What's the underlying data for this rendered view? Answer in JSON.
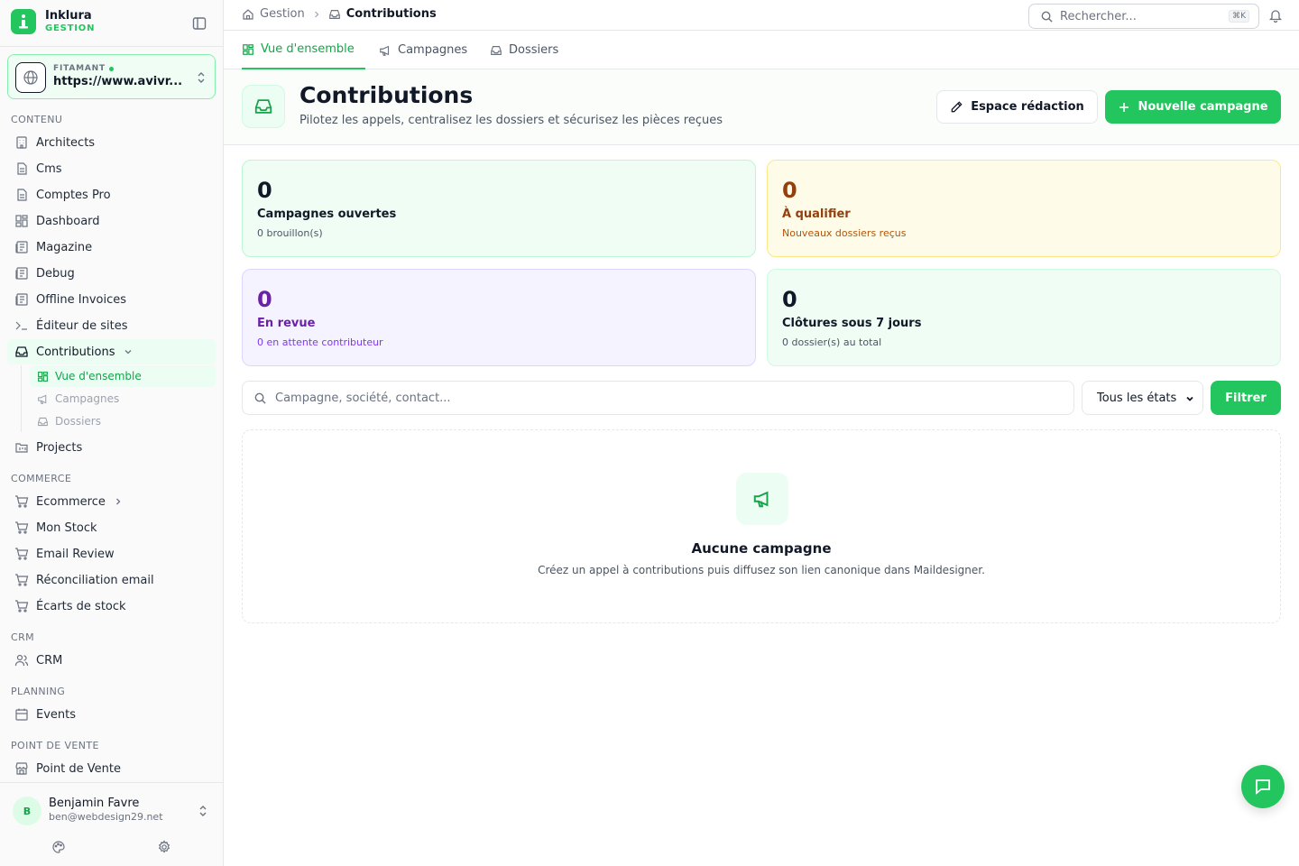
{
  "brand": {
    "name": "Inklura",
    "subtitle": "GESTION"
  },
  "site": {
    "label": "FITAMANT",
    "url": "https://www.avivr..."
  },
  "sidebar": {
    "sections": {
      "contenu": "CONTENU",
      "commerce": "COMMERCE",
      "crm": "CRM",
      "planning": "PLANNING",
      "pdv": "POINT DE VENTE"
    },
    "items": {
      "architects": "Architects",
      "cms": "Cms",
      "comptes_pro": "Comptes Pro",
      "dashboard": "Dashboard",
      "magazine": "Magazine",
      "debug": "Debug",
      "offline_invoices": "Offline Invoices",
      "editeur": "Éditeur de sites",
      "contributions": "Contributions",
      "projects": "Projects",
      "ecommerce": "Ecommerce",
      "mon_stock": "Mon Stock",
      "email_review": "Email Review",
      "reconciliation": "Réconciliation email",
      "ecarts": "Écarts de stock",
      "crm": "CRM",
      "events": "Events",
      "point_de_vente": "Point de Vente"
    },
    "subitems": {
      "overview": "Vue d'ensemble",
      "campagnes": "Campagnes",
      "dossiers": "Dossiers"
    }
  },
  "user": {
    "initial": "B",
    "name": "Benjamin Favre",
    "email": "ben@webdesign29.net"
  },
  "breadcrumb": {
    "root": "Gestion",
    "current": "Contributions"
  },
  "search": {
    "placeholder": "Rechercher...",
    "shortcut": "⌘K"
  },
  "tabs": {
    "overview": "Vue d'ensemble",
    "campagnes": "Campagnes",
    "dossiers": "Dossiers"
  },
  "header": {
    "title": "Contributions",
    "subtitle": "Pilotez les appels, centralisez les dossiers et sécurisez les pièces reçues",
    "redaction_label": "Espace rédaction",
    "new_campaign_label": "Nouvelle campagne"
  },
  "stats": {
    "open": {
      "value": "0",
      "label": "Campagnes ouvertes",
      "hint": "0 brouillon(s)"
    },
    "qualify": {
      "value": "0",
      "label": "À qualifier",
      "hint": "Nouveaux dossiers reçus"
    },
    "review": {
      "value": "0",
      "label": "En revue",
      "hint": "0 en attente contributeur"
    },
    "closing": {
      "value": "0",
      "label": "Clôtures sous 7 jours",
      "hint": "0 dossier(s) au total"
    }
  },
  "filters": {
    "search_placeholder": "Campagne, société, contact...",
    "state_selected": "Tous les états",
    "filter_label": "Filtrer"
  },
  "empty": {
    "title": "Aucune campagne",
    "subtitle": "Créez un appel à contributions puis diffusez son lien canonique dans Maildesigner."
  },
  "colors": {
    "accent": "#22c55e",
    "accent_dark": "#16a34a"
  },
  "icons": {
    "sidebar": [
      "building-icon",
      "file-icon",
      "layout-grid-icon",
      "newspaper-icon",
      "terminal-icon",
      "inbox-icon",
      "folder-kanban-icon",
      "cart-icon",
      "users-icon",
      "calendar-icon",
      "store-icon"
    ],
    "misc": [
      "home-icon",
      "search-icon",
      "bell-icon",
      "pencil-icon",
      "plus-icon",
      "megaphone-icon",
      "chat-icon",
      "palette-icon",
      "gear-icon"
    ]
  }
}
